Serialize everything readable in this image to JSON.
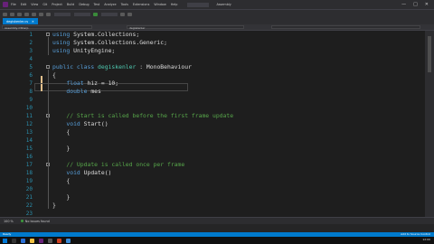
{
  "menu": {
    "items": [
      "File",
      "Edit",
      "View",
      "Git",
      "Project",
      "Build",
      "Debug",
      "Test",
      "Analyze",
      "Tools",
      "Extensions",
      "Window",
      "Help"
    ],
    "search_label": "Search",
    "project_name": "Assembly"
  },
  "window_controls": {
    "minimize": "—",
    "maximize": "□",
    "close": "✕"
  },
  "tab": {
    "label": "degiskenler.cs",
    "close": "✕"
  },
  "nav": {
    "left": "Assembly-CSharp",
    "middle": "degiskenler",
    "right": ""
  },
  "editor": {
    "line_numbers": [
      "1",
      "2",
      "3",
      "4",
      "5",
      "6",
      "7",
      "8",
      "9",
      "10",
      "11",
      "12",
      "13",
      "14",
      "15",
      "16",
      "17",
      "18",
      "19",
      "20",
      "21",
      "22",
      "23"
    ],
    "lines": [
      {
        "kw": "using",
        "rest": " System.Collections;"
      },
      {
        "kw": "using",
        "rest": " System.Collections.Generic;"
      },
      {
        "kw": "using",
        "rest": " UnityEngine;"
      },
      {},
      {
        "kw": "public class",
        "type": "degiskenler",
        "rest": " : MonoBehaviour"
      },
      {
        "plain": "{"
      },
      {
        "indent": "    ",
        "kw": "float",
        "rest": " hiz = 10;"
      },
      {
        "indent": "    ",
        "kw": "double",
        "rest": " mes"
      },
      {},
      {},
      {
        "indent": "    ",
        "comment": "// Start is called before the first frame update"
      },
      {
        "indent": "    ",
        "kw": "void",
        "rest": " Start()"
      },
      {
        "plain": "    {"
      },
      {},
      {
        "plain": "    }"
      },
      {},
      {
        "indent": "    ",
        "comment": "// Update is called once per frame"
      },
      {
        "indent": "    ",
        "kw": "void",
        "rest": " Update()"
      },
      {
        "plain": "    {"
      },
      {},
      {
        "plain": "    }"
      },
      {
        "plain": "}"
      },
      {}
    ]
  },
  "bottom": {
    "zoom": "100 %",
    "issues": "No issues found"
  },
  "status": {
    "left": "Ready",
    "right": "Add to Source Control"
  },
  "taskbar": {
    "time": "12:00",
    "date": ""
  },
  "colors": {
    "accent": "#007acc",
    "keyword": "#569cd6",
    "type": "#4ec9b0",
    "comment": "#57a64a",
    "line_number": "#2b91af"
  }
}
